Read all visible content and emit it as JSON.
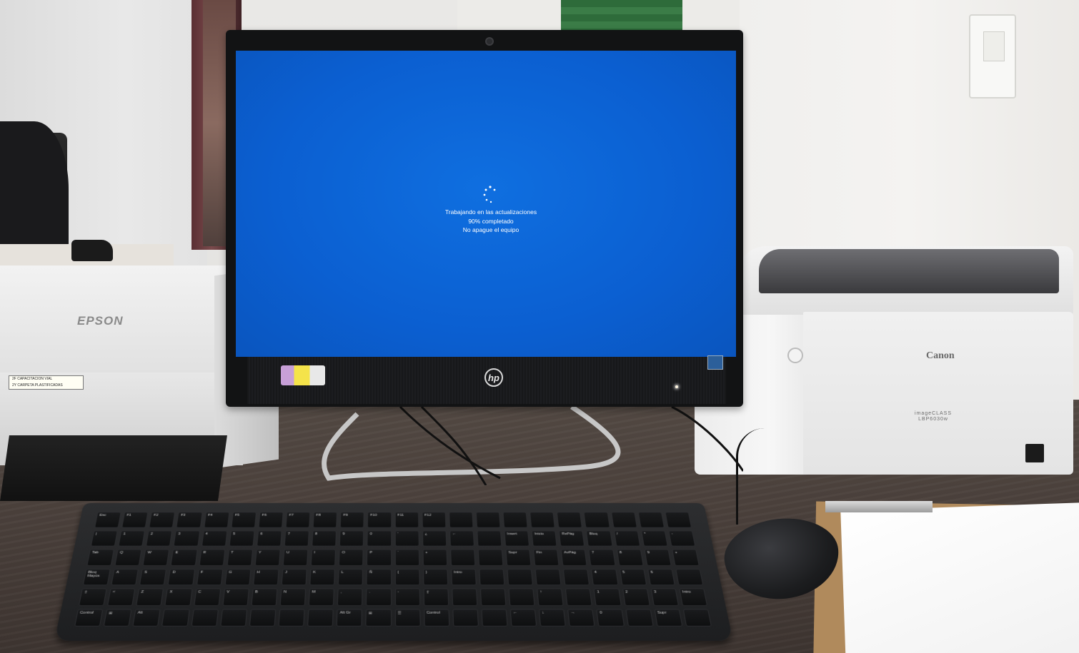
{
  "screen": {
    "status_lines": [
      "Trabajando en las actualizaciones",
      "90% completado",
      "No apague el equipo"
    ],
    "progress_percent": 90,
    "background_color": "#0b5fd1",
    "text_color": "#ffffff"
  },
  "devices": {
    "monitor_brand": "hp",
    "scanner_brand": "EPSON",
    "scanner_label_lines": [
      "2F CAPACITACION VIAL",
      "2Y CARPETA PLASTIFICADAS"
    ],
    "printer_brand": "Canon",
    "printer_model_lines": [
      "imageCLASS",
      "LBP6030w"
    ]
  },
  "keyboard": {
    "rows": [
      [
        "Esc",
        "F1",
        "F2",
        "F3",
        "F4",
        "F5",
        "F6",
        "F7",
        "F8",
        "F9",
        "F10",
        "F11",
        "F12",
        "",
        "",
        "",
        "",
        "",
        "",
        "",
        "",
        ""
      ],
      [
        "|",
        "1",
        "2",
        "3",
        "4",
        "5",
        "6",
        "7",
        "8",
        "9",
        "0",
        "'",
        "¿",
        "←",
        "",
        "Insert",
        "Inicio",
        "RePág",
        "Bloq",
        "/",
        "*",
        "-"
      ],
      [
        "Tab",
        "Q",
        "W",
        "E",
        "R",
        "T",
        "Y",
        "U",
        "I",
        "O",
        "P",
        "´",
        "+",
        "",
        "",
        "Supr",
        "Fin",
        "AvPág",
        "7",
        "8",
        "9",
        "+"
      ],
      [
        "Bloq Mayús",
        "A",
        "S",
        "D",
        "F",
        "G",
        "H",
        "J",
        "K",
        "L",
        "Ñ",
        "{",
        "}",
        "Intro",
        "",
        "",
        "",
        "",
        "4",
        "5",
        "6",
        ""
      ],
      [
        "⇧",
        "<",
        "Z",
        "X",
        "C",
        "V",
        "B",
        "N",
        "M",
        ",",
        ".",
        "-",
        "⇧",
        "",
        "",
        "",
        "↑",
        "",
        "1",
        "2",
        "3",
        "Intro"
      ],
      [
        "Control",
        "⊞",
        "Alt",
        "",
        "",
        "",
        "",
        "",
        "",
        "Alt Gr",
        "⊞",
        "☰",
        "Control",
        "",
        "",
        "←",
        "↓",
        "→",
        "0",
        "",
        "Supr",
        ""
      ]
    ]
  }
}
